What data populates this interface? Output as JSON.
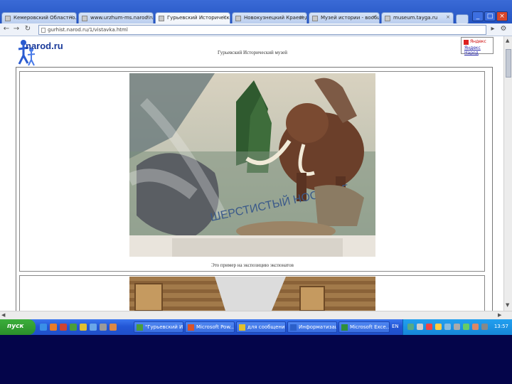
{
  "browser": {
    "tabs": [
      {
        "label": "Кемеровский Областно..."
      },
      {
        "label": "www.urzhum-ms.narod.ru"
      },
      {
        "label": "Гурьевский Историческ..."
      },
      {
        "label": "Новокузнецкий Краевед..."
      },
      {
        "label": "Музей истории - вообще"
      },
      {
        "label": "museum.tayga.ru"
      }
    ],
    "active_tab_index": 2,
    "address": "gurhist.narod.ru/1/vistavka.html",
    "window_controls": [
      "_",
      "□",
      "×"
    ]
  },
  "page": {
    "logo_text": "narod.ru",
    "title": "Гурьевский Исторический музей",
    "ad_top": "Яндекс",
    "ad_link": "Яндекс Народ",
    "caption": "Это пример на экспозицию экспонатов"
  },
  "taskbar": {
    "start_label": "пуск",
    "buttons": [
      {
        "label": "\"Гурьевский И..."
      },
      {
        "label": "Microsoft Pow..."
      },
      {
        "label": "для сообщения"
      },
      {
        "label": "Информатизация"
      },
      {
        "label": "Microsoft Exce..."
      }
    ],
    "lang": "EN",
    "clock": "13:57"
  },
  "colors": {
    "taskbar_blue": "#2356d6",
    "start_green": "#2a8f2a",
    "bottom_band": "#04054a"
  }
}
